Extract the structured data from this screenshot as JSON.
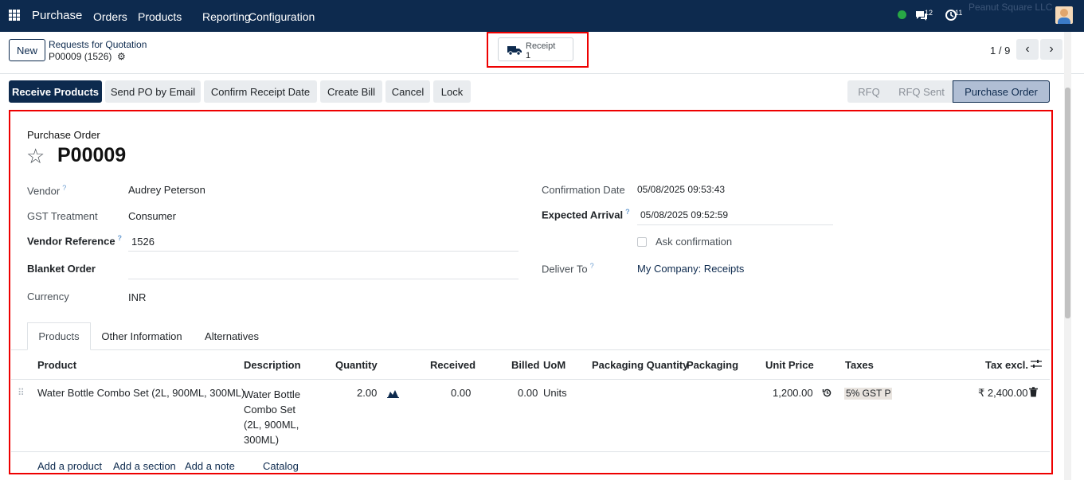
{
  "topbar": {
    "app_name": "Purchase",
    "menus": [
      "Orders",
      "Products",
      "Reporting",
      "Configuration"
    ],
    "chat_count": "12",
    "activity_count": "11",
    "company": "Peanut Square LLC"
  },
  "control": {
    "new_label": "New",
    "breadcrumb_parent": "Requests for Quotation",
    "breadcrumb_current": "P00009 (1526)",
    "smart_button": {
      "label": "Receipt",
      "count": "1"
    },
    "pager": "1 / 9"
  },
  "actions": [
    "Receive Products",
    "Send PO by Email",
    "Confirm Receipt Date",
    "Create Bill",
    "Cancel",
    "Lock"
  ],
  "statusbar": [
    "RFQ",
    "RFQ Sent",
    "Purchase Order"
  ],
  "form": {
    "doc_type": "Purchase Order",
    "name": "P00009",
    "vendor_label": "Vendor",
    "vendor": "Audrey Peterson",
    "gst_label": "GST Treatment",
    "gst": "Consumer",
    "vendor_ref_label": "Vendor Reference",
    "vendor_ref": "1526",
    "blanket_label": "Blanket Order",
    "currency_label": "Currency",
    "currency": "INR",
    "confirmation_label": "Confirmation Date",
    "confirmation": "05/08/2025 09:53:43",
    "expected_label": "Expected Arrival",
    "expected": "05/08/2025 09:52:59",
    "ask_confirmation": "Ask confirmation",
    "deliver_label": "Deliver To",
    "deliver": "My Company: Receipts"
  },
  "tabs": [
    "Products",
    "Other Information",
    "Alternatives"
  ],
  "table": {
    "headers": [
      "Product",
      "Description",
      "Quantity",
      "Received",
      "Billed",
      "UoM",
      "Packaging Quantity",
      "Packaging",
      "Unit Price",
      "Taxes",
      "Tax excl."
    ],
    "row": {
      "product": "Water Bottle Combo Set (2L, 900ML, 300ML)",
      "description_lines": [
        "Water Bottle",
        "Combo Set",
        "(2L, 900ML,",
        "300ML)"
      ],
      "quantity": "2.00",
      "received": "0.00",
      "billed": "0.00",
      "uom": "Units",
      "unit_price": "1,200.00",
      "taxes": "5% GST P",
      "tax_excl": "₹ 2,400.00"
    },
    "footer_links": [
      "Add a product",
      "Add a section",
      "Add a note",
      "Catalog"
    ]
  }
}
